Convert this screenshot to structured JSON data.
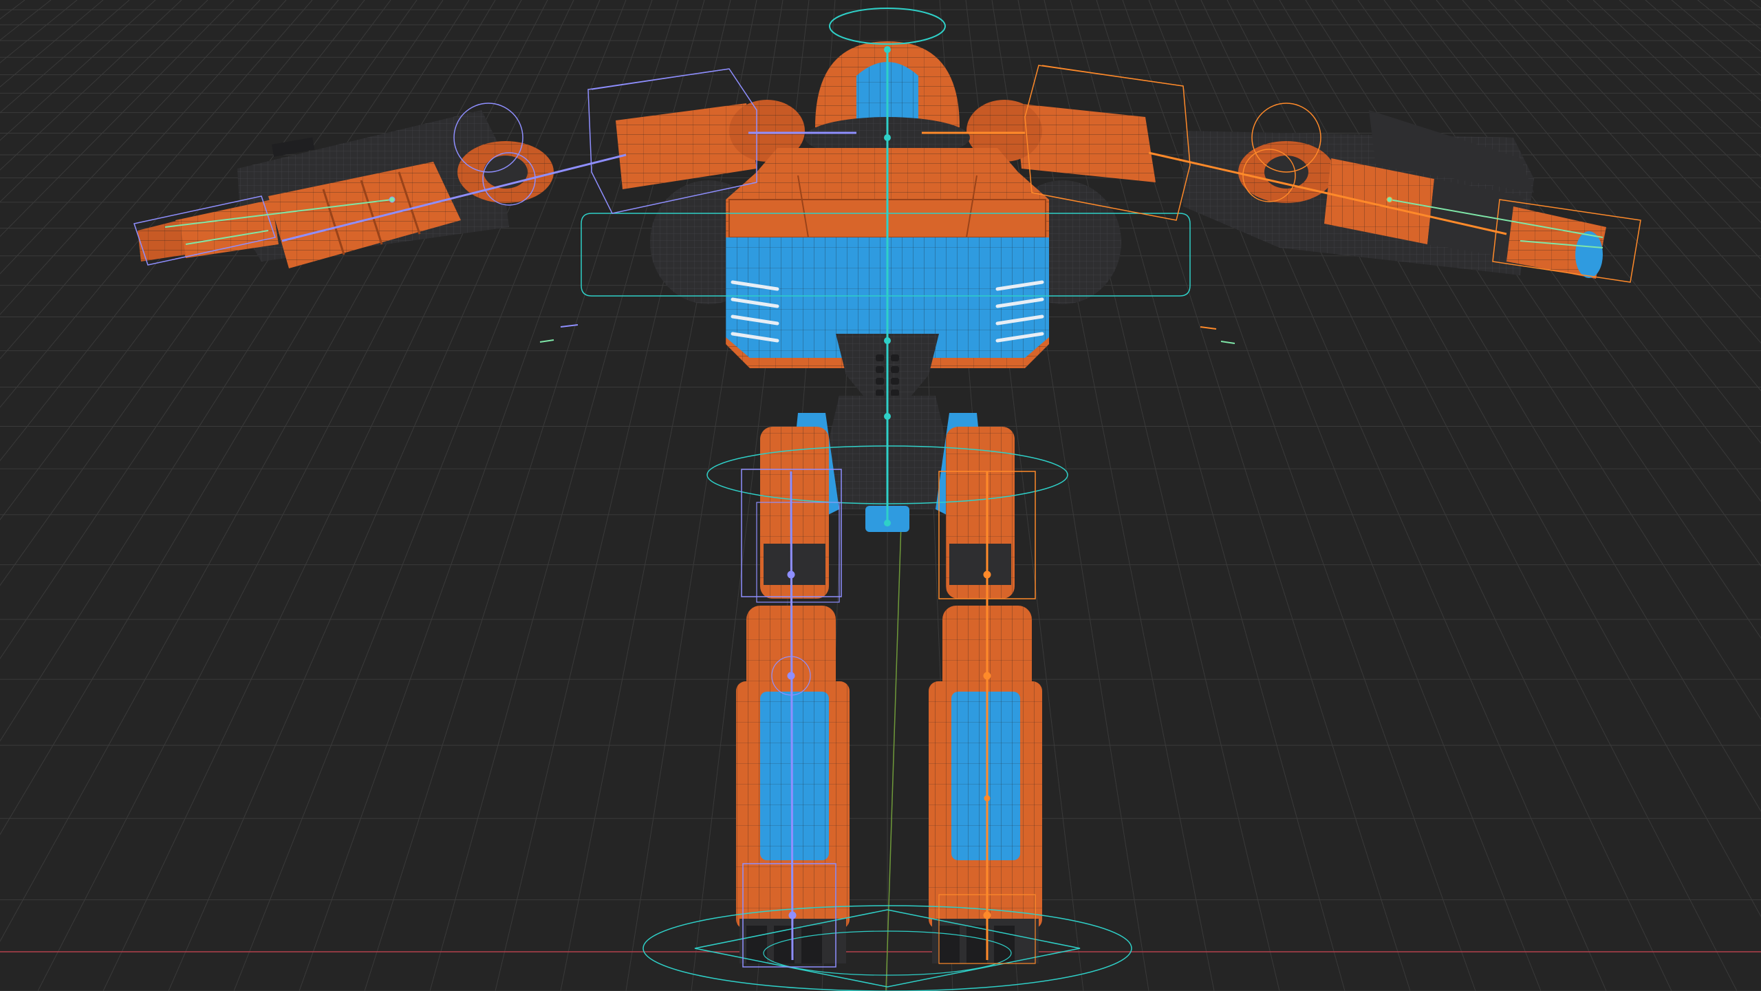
{
  "viewport": {
    "mode": "3d-viewport",
    "background_color": "#252525",
    "grid_color": "#3a3a3a",
    "x_axis_color": "#b3414d",
    "y_axis_color": "#6f9a3a"
  },
  "model": {
    "type": "robot",
    "pose": "t-pose",
    "display": "wireframe-overlay",
    "colors": {
      "armor_orange": "#d8652a",
      "armor_orange_dark": "#b04e1f",
      "panel_blue": "#2f9be0",
      "joint_dark": "#2e2e30"
    }
  },
  "rig": {
    "left_side_color": "#8f8fff",
    "right_side_color": "#ff8a2a",
    "center_color": "#2fd0c8",
    "bones": [
      {
        "name": "spine",
        "side": "center"
      },
      {
        "name": "head",
        "side": "center"
      },
      {
        "name": "upper-arm",
        "side": "left"
      },
      {
        "name": "forearm",
        "side": "left"
      },
      {
        "name": "hand",
        "side": "left"
      },
      {
        "name": "upper-arm",
        "side": "right"
      },
      {
        "name": "forearm",
        "side": "right"
      },
      {
        "name": "hand",
        "side": "right"
      },
      {
        "name": "thigh",
        "side": "left"
      },
      {
        "name": "shin",
        "side": "left"
      },
      {
        "name": "thigh",
        "side": "right"
      },
      {
        "name": "shin",
        "side": "right"
      }
    ],
    "controls": [
      "head-circle",
      "chest-box",
      "hip-circle",
      "root-circle",
      "shoulder-box",
      "hand-ik-box",
      "leg-ik-box"
    ]
  }
}
